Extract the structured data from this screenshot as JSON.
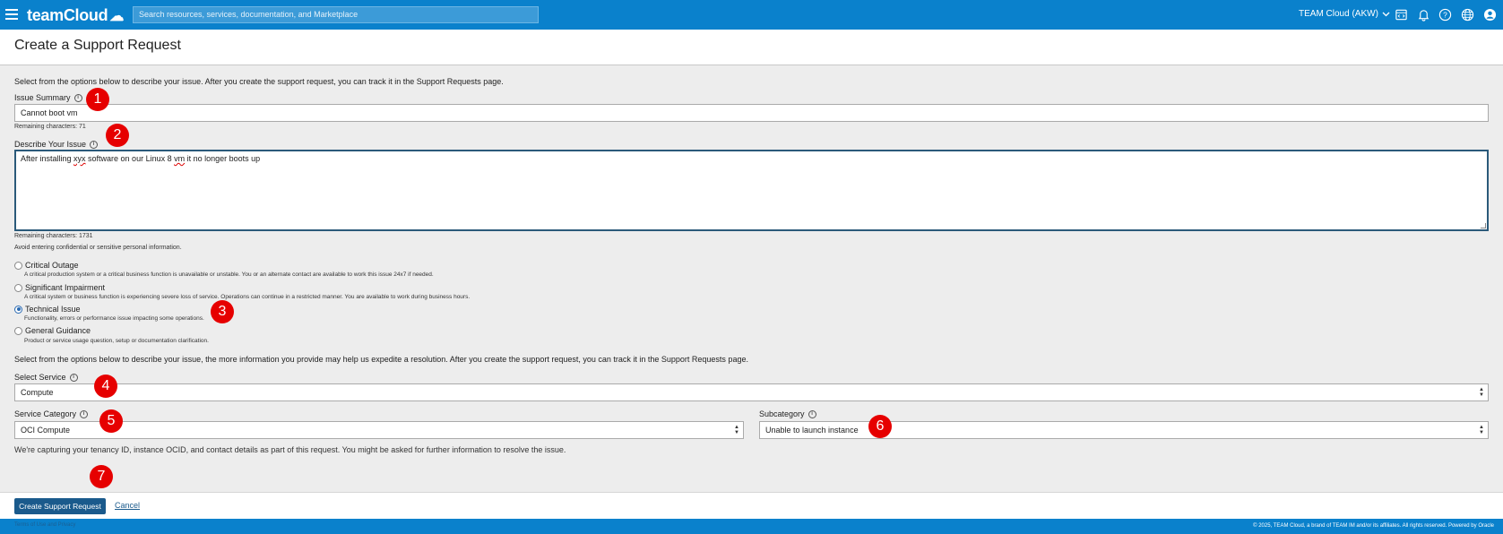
{
  "topbar": {
    "brand": "teamCloud",
    "search_placeholder": "Search resources, services, documentation, and Marketplace",
    "tenancy": "TEAM Cloud (AKW)",
    "icons": [
      "code-editor-icon",
      "bell-icon",
      "help-icon",
      "globe-icon",
      "user-icon"
    ]
  },
  "page": {
    "title": "Create a Support Request"
  },
  "form": {
    "intro": "Select from the options below to describe your issue. After you create the support request, you can track it in the Support Requests page.",
    "issue_summary": {
      "label": "Issue Summary",
      "value": "Cannot boot vm",
      "remaining": "Remaining characters: 71"
    },
    "describe_issue": {
      "label": "Describe Your Issue",
      "value_parts": [
        "After installing ",
        "xyx",
        " software on our Linux 8 ",
        "vm",
        " it no longer boots up"
      ],
      "remaining": "Remaining characters: 1731",
      "hint": "Avoid entering confidential or sensitive personal information."
    },
    "severity": [
      {
        "label": "Critical Outage",
        "desc": "A critical production system or a critical business function is unavailable or unstable. You or an alternate contact are available to work this issue 24x7 if needed.",
        "checked": false
      },
      {
        "label": "Significant Impairment",
        "desc": "A critical system or business function is experiencing severe loss of service. Operations can continue in a restricted manner. You are available to work during business hours.",
        "checked": false
      },
      {
        "label": "Technical Issue",
        "desc": "Functionality, errors or performance issue impacting some operations.",
        "checked": true
      },
      {
        "label": "General Guidance",
        "desc": "Product or service usage question, setup or documentation clarification.",
        "checked": false
      }
    ],
    "intro2": "Select from the options below to describe your issue, the more information you provide may help us expedite a resolution. After you create the support request, you can track it in the Support Requests page.",
    "select_service": {
      "label": "Select Service",
      "value": "Compute"
    },
    "service_category": {
      "label": "Service Category",
      "value": "OCI Compute"
    },
    "subcategory": {
      "label": "Subcategory",
      "value": "Unable to launch instance"
    },
    "capture_note": "We're capturing your tenancy ID, instance OCID, and contact details as part of this request. You might be asked for further information to resolve the issue."
  },
  "badges": [
    "1",
    "2",
    "3",
    "4",
    "5",
    "6",
    "7"
  ],
  "actions": {
    "submit": "Create Support Request",
    "cancel": "Cancel"
  },
  "footer": {
    "left": "Terms of Use and Privacy",
    "right": "© 2025, TEAM Cloud, a brand of TEAM IM and/or its affiliates. All rights reserved.   Powered by Oracle"
  },
  "colors": {
    "topbar": "#0a81cc",
    "badge": "#e60000",
    "primary_button": "#1a5a8c"
  }
}
